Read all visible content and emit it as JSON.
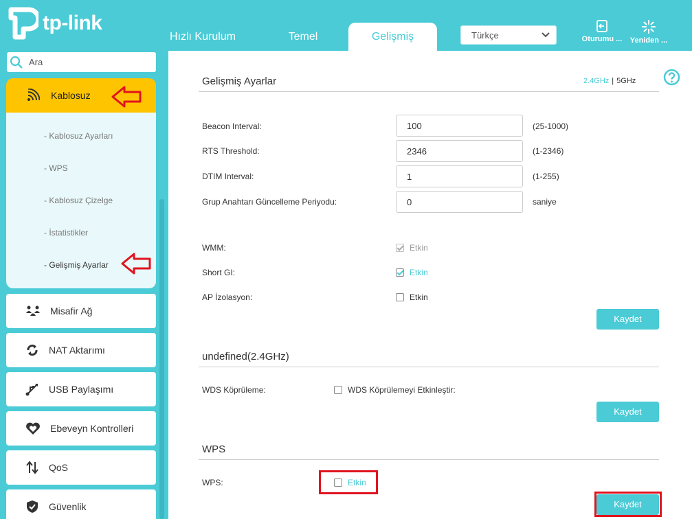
{
  "brand": {
    "name": "tp-link"
  },
  "header": {
    "tabs": [
      {
        "label": "Hızlı Kurulum"
      },
      {
        "label": "Temel"
      },
      {
        "label": "Gelişmiş"
      }
    ],
    "language": "Türkçe",
    "logout_label": "Oturumu ...",
    "reboot_label": "Yeniden ..."
  },
  "sidebar": {
    "search_placeholder": "Ara",
    "active_item": "Kablosuz",
    "submenu": [
      {
        "label": "- Kablosuz Ayarları"
      },
      {
        "label": "- WPS"
      },
      {
        "label": "- Kablosuz Çizelge"
      },
      {
        "label": "- İstatistikler"
      },
      {
        "label": "- Gelişmiş Ayarlar"
      }
    ],
    "items": [
      {
        "label": "Misafir Ağ",
        "icon": "guest-network-icon"
      },
      {
        "label": "NAT Aktarımı",
        "icon": "nat-icon"
      },
      {
        "label": "USB Paylaşımı",
        "icon": "usb-icon"
      },
      {
        "label": "Ebeveyn Kontrolleri",
        "icon": "heart-icon"
      },
      {
        "label": "QoS",
        "icon": "qos-arrows-icon"
      },
      {
        "label": "Güvenlik",
        "icon": "shield-icon"
      }
    ]
  },
  "advanced": {
    "title": "Gelişmiş Ayarlar",
    "band_24": "2.4GHz",
    "band_sep": "|",
    "band_5": "5GHz",
    "fields": [
      {
        "label": "Beacon Interval:",
        "value": "100",
        "range": "(25-1000)"
      },
      {
        "label": "RTS Threshold:",
        "value": "2346",
        "range": "(1-2346)"
      },
      {
        "label": "DTIM Interval:",
        "value": "1",
        "range": "(1-255)"
      },
      {
        "label": "Grup Anahtarı Güncelleme Periyodu:",
        "value": "0",
        "range": "saniye"
      }
    ],
    "wmm": {
      "label": "WMM:",
      "text": "Etkin",
      "checked": true,
      "disabled": true
    },
    "short_gi": {
      "label": "Short GI:",
      "text": "Etkin",
      "checked": true
    },
    "ap_isolation": {
      "label": "AP İzolasyon:",
      "text": "Etkin",
      "checked": false
    },
    "save_label": "Kaydet"
  },
  "wds": {
    "title": "undefined(2.4GHz)",
    "label": "WDS Köprüleme:",
    "checkbox_text": "WDS Köprülemeyi Etkinleştir:",
    "checked": false,
    "save_label": "Kaydet"
  },
  "wps": {
    "title": "WPS",
    "label": "WPS:",
    "checkbox_text": "Etkin",
    "checked": false,
    "save_label": "Kaydet"
  },
  "colors": {
    "accent": "#4acbd6",
    "active_menu": "#ffc400",
    "highlight": "#e0141e"
  }
}
